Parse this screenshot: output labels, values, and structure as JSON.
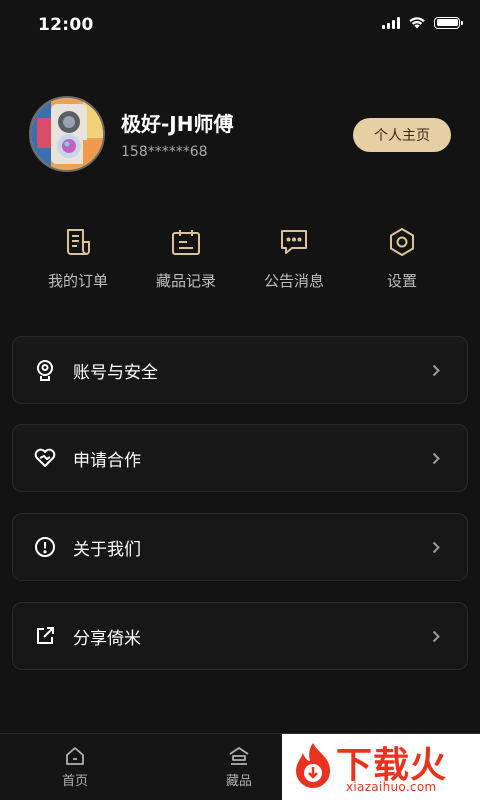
{
  "status_bar": {
    "time": "12:00"
  },
  "profile": {
    "nickname": "极好-JH师傅",
    "phone": "158******68",
    "homepage_button": "个人主页"
  },
  "quick_actions": [
    {
      "label": "我的订单",
      "icon": "order-document-icon"
    },
    {
      "label": "藏品记录",
      "icon": "calendar-record-icon"
    },
    {
      "label": "公告消息",
      "icon": "message-bubble-icon"
    },
    {
      "label": "设置",
      "icon": "hexagon-settings-icon"
    }
  ],
  "menu": [
    {
      "label": "账号与安全",
      "icon": "account-security-icon"
    },
    {
      "label": "申请合作",
      "icon": "heart-handshake-icon"
    },
    {
      "label": "关于我们",
      "icon": "info-exclamation-icon"
    },
    {
      "label": "分享倚米",
      "icon": "share-external-icon"
    }
  ],
  "tabbar": {
    "tabs": [
      {
        "label": "首页",
        "icon": "home-icon"
      },
      {
        "label": "藏品",
        "icon": "collection-icon"
      }
    ]
  },
  "watermark": {
    "text": "下载火",
    "url": "xiazaihuo.com"
  },
  "colors": {
    "background": "#131313",
    "card": "#171717",
    "accent_gold": "#e6cfa3",
    "icon_gold": "#d9c39b",
    "watermark_red": "#e8331f"
  }
}
